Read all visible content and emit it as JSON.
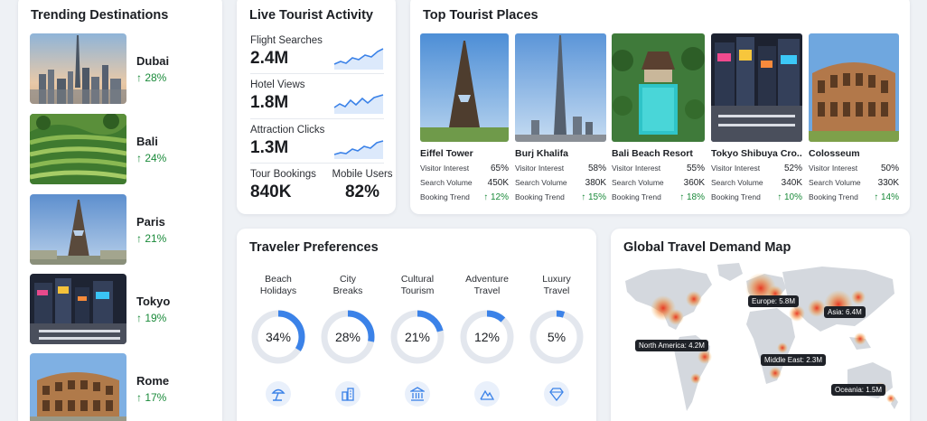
{
  "trending": {
    "title": "Trending Destinations",
    "items": [
      {
        "name": "Dubai",
        "change": "↑ 28%"
      },
      {
        "name": "Bali",
        "change": "↑ 24%"
      },
      {
        "name": "Paris",
        "change": "↑ 21%"
      },
      {
        "name": "Tokyo",
        "change": "↑ 19%"
      },
      {
        "name": "Rome",
        "change": "↑ 17%"
      }
    ]
  },
  "live": {
    "title": "Live Tourist Activity",
    "metrics": [
      {
        "label": "Flight Searches",
        "value": "2.4M"
      },
      {
        "label": "Hotel Views",
        "value": "1.8M"
      },
      {
        "label": "Attraction Clicks",
        "value": "1.3M"
      }
    ],
    "tour": {
      "label": "Tour Bookings",
      "value": "840K"
    },
    "mobile": {
      "label": "Mobile Users",
      "value": "82%"
    }
  },
  "places": {
    "title": "Top Tourist Places",
    "row_labels": {
      "interest": "Visitor Interest",
      "volume": "Search Volume",
      "trend": "Booking Trend"
    },
    "items": [
      {
        "name": "Eiffel Tower",
        "interest": "65%",
        "volume": "450K",
        "trend": "↑ 12%"
      },
      {
        "name": "Burj Khalifa",
        "interest": "58%",
        "volume": "380K",
        "trend": "↑ 15%"
      },
      {
        "name": "Bali Beach Resort",
        "interest": "55%",
        "volume": "360K",
        "trend": "↑ 18%"
      },
      {
        "name": "Tokyo Shibuya Cro...",
        "interest": "52%",
        "volume": "340K",
        "trend": "↑ 10%"
      },
      {
        "name": "Colosseum",
        "interest": "50%",
        "volume": "330K",
        "trend": "↑ 14%"
      }
    ]
  },
  "prefs": {
    "title": "Traveler Preferences",
    "items": [
      {
        "label_line1": "Beach",
        "label_line2": "Holidays",
        "value": "34%",
        "fraction": 0.34,
        "icon": "beach-umbrella-icon"
      },
      {
        "label_line1": "City",
        "label_line2": "Breaks",
        "value": "28%",
        "fraction": 0.28,
        "icon": "city-buildings-icon"
      },
      {
        "label_line1": "Cultural",
        "label_line2": "Tourism",
        "value": "21%",
        "fraction": 0.21,
        "icon": "museum-icon"
      },
      {
        "label_line1": "Adventure",
        "label_line2": "Travel",
        "value": "12%",
        "fraction": 0.12,
        "icon": "mountain-icon"
      },
      {
        "label_line1": "Luxury",
        "label_line2": "Travel",
        "value": "5%",
        "fraction": 0.05,
        "icon": "diamond-icon"
      }
    ]
  },
  "map": {
    "title": "Global Travel Demand Map",
    "labels": {
      "na": "North America: 4.2M",
      "eu": "Europe: 5.8M",
      "asia": "Asia: 6.4M",
      "me": "Middle East: 2.3M",
      "oc": "Oceania: 1.5M"
    }
  },
  "colors": {
    "accent": "#3b82e8",
    "ring_track": "#e3e7ee",
    "positive": "#1a8a3a",
    "heat": "#e83a1a"
  }
}
